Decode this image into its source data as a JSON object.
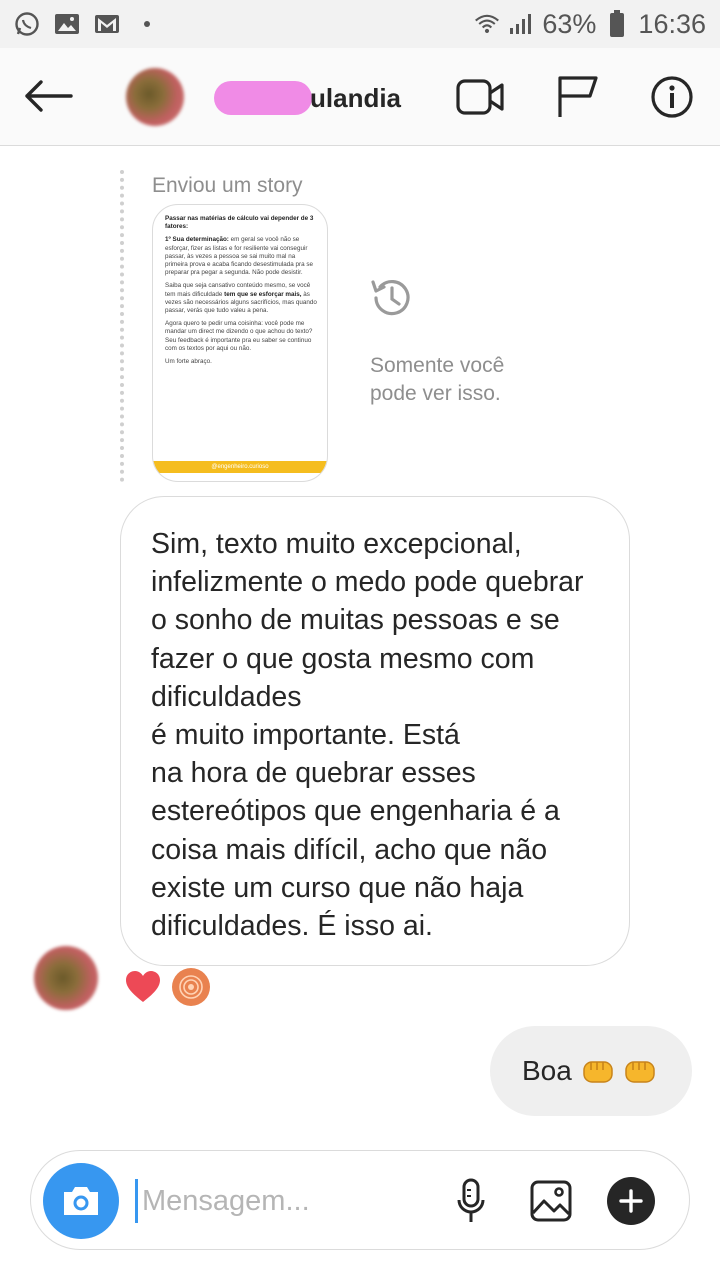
{
  "status_bar": {
    "battery": "63%",
    "time": "16:36",
    "icons": [
      "whatsapp-icon",
      "gallery-icon",
      "gmail-icon",
      "wifi-icon",
      "signal-icon",
      "battery-icon"
    ]
  },
  "header": {
    "username_suffix": "ulandia",
    "buttons": [
      "back-arrow-icon",
      "video-call-icon",
      "flag-icon",
      "info-icon"
    ]
  },
  "story_reply": {
    "label": "Enviou um story",
    "story_text": {
      "title": "Passar nas matérias de cálculo vai depender de 3 fatores:",
      "p1_bold": "1º Sua determinação:",
      "p1": " em geral se você não se esforçar, fizer as listas e for resiliente vai conseguir passar, às vezes a pessoa se sai muito mal na primeira prova e acaba ficando desestimulada pra se preparar pra pegar a segunda. Não pode desistir.",
      "p2_bold": "tem que se esforçar mais,",
      "p2a": "Saiba que seja cansativo conteúdo mesmo, se você tem mais dificuldade ",
      "p2b": " às vezes são necessários alguns sacrifícios, mas quando passar, verás que tudo valeu a pena.",
      "p3": "Agora quero te pedir uma coisinha: você pode me mandar um direct me dizendo o que achou do texto? Seu feedback é importante pra eu saber se continuo com os textos por aqui ou não.",
      "p4": "Um forte abraço.",
      "footer": "@engenheiro.curioso"
    },
    "visibility_note": "Somente você pode ver isso."
  },
  "messages": {
    "received": "Sim, texto muito excepcional, infelizmente o medo pode quebrar o sonho de muitas pessoas e se fazer o que gosta mesmo com dificuldades\né muito importante.  Está\nna hora de quebrar esses estereótipos que engenharia é a coisa mais difícil, acho que não existe um curso que não haja dificuldades. É  isso ai.",
    "reactions": [
      "heart",
      "emoji-badge"
    ],
    "sent": "Boa",
    "sent_emoji": [
      "fist-bump-icon",
      "fist-bump-icon"
    ]
  },
  "composer": {
    "placeholder": "Mensagem..."
  },
  "colors": {
    "accent": "#3797f0",
    "heart": "#ed4956",
    "username_blur": "#f08be6",
    "story_footer": "#f5bd1f"
  }
}
